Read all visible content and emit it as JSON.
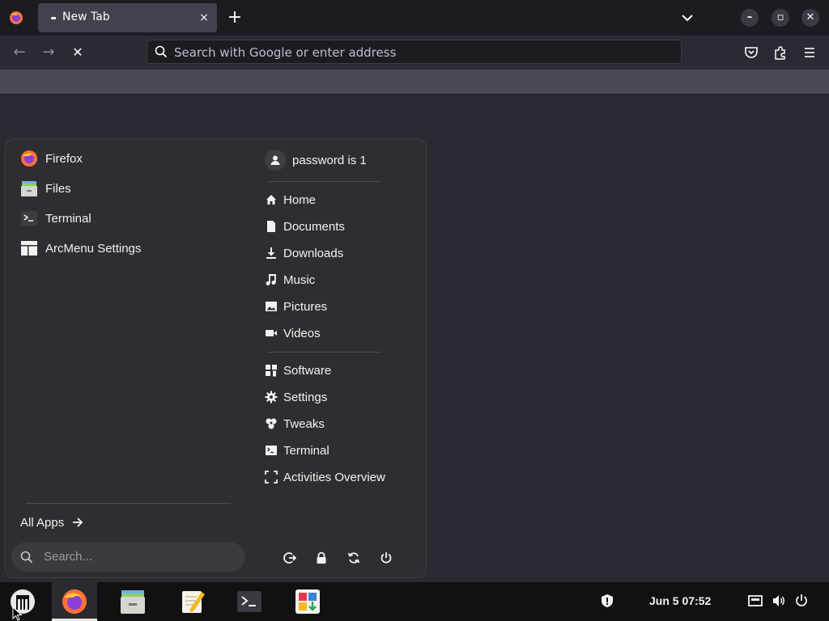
{
  "browser": {
    "tab_title": "New Tab",
    "url_placeholder": "Search with Google or enter address",
    "tab_close": "×",
    "new_tab": "+",
    "back": "←",
    "forward": "→",
    "stop": "✕",
    "win_minimize": "–",
    "win_maximize": "▫",
    "win_close": "✕"
  },
  "menu": {
    "apps": [
      {
        "label": "Firefox",
        "icon": "firefox-icon"
      },
      {
        "label": "Files",
        "icon": "files-icon"
      },
      {
        "label": "Terminal",
        "icon": "terminal-icon"
      },
      {
        "label": "ArcMenu Settings",
        "icon": "arcmenu-settings-icon"
      }
    ],
    "user": "password is 1",
    "places": [
      {
        "label": "Home",
        "icon": "home-icon"
      },
      {
        "label": "Documents",
        "icon": "document-icon"
      },
      {
        "label": "Downloads",
        "icon": "download-icon"
      },
      {
        "label": "Music",
        "icon": "music-icon"
      },
      {
        "label": "Pictures",
        "icon": "picture-icon"
      },
      {
        "label": "Videos",
        "icon": "video-icon"
      }
    ],
    "system": [
      {
        "label": "Software",
        "icon": "software-icon"
      },
      {
        "label": "Settings",
        "icon": "settings-icon"
      },
      {
        "label": "Tweaks",
        "icon": "tweaks-icon"
      },
      {
        "label": "Terminal",
        "icon": "terminal-icon"
      },
      {
        "label": "Activities Overview",
        "icon": "activities-icon"
      }
    ],
    "all_apps": "All Apps",
    "search_placeholder": "Search...",
    "power_buttons": [
      "logout-icon",
      "lock-icon",
      "restart-icon",
      "power-icon"
    ]
  },
  "taskbar": {
    "launchers": [
      "arcmenu-logo-icon",
      "firefox-icon",
      "files-icon",
      "text-editor-icon",
      "terminal-icon",
      "software-icon"
    ],
    "clock": "Jun 5  07:52",
    "tray": [
      "shield-icon",
      "network-icon",
      "volume-icon",
      "power-icon"
    ]
  },
  "colors": {
    "accent_firefox": "#ff7139",
    "menu_bg": "#2e2e32",
    "taskbar_bg": "#111114"
  }
}
